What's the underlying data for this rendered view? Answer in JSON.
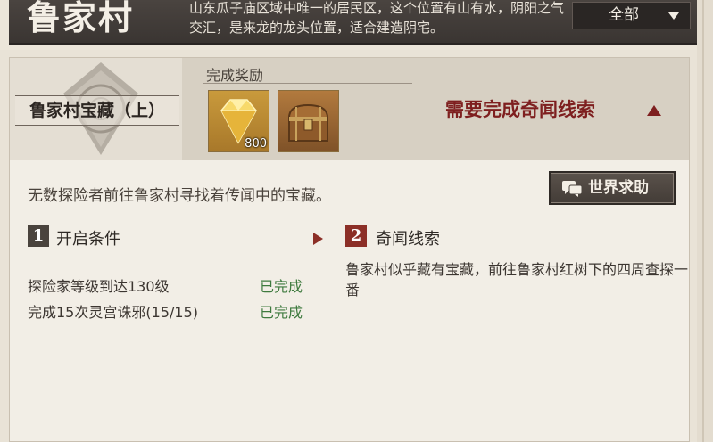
{
  "header": {
    "village_name": "鲁家村",
    "description": "山东瓜子庙区域中唯一的居民区，这个位置有山有水，阴阳之气交汇，是来龙的龙头位置，适合建造阴宅。",
    "filter_value": "全部"
  },
  "quest": {
    "name": "鲁家村宝藏（上）",
    "reward_label": "完成奖励",
    "rewards": [
      {
        "icon": "gold-diamond-icon",
        "count": "800"
      },
      {
        "icon": "treasure-chest-icon",
        "count": ""
      }
    ],
    "requirement": "需要完成奇闻线索",
    "description": "无数探险者前往鲁家村寻找着传闻中的宝藏。",
    "help_label": "世界求助"
  },
  "sections": {
    "conditions": {
      "number": "1",
      "title": "开启条件",
      "items": [
        {
          "label": "探险家等级到达130级",
          "status": "已完成"
        },
        {
          "label": "完成15次灵宫诛邪(15/15)",
          "status": "已完成"
        }
      ]
    },
    "clue": {
      "number": "2",
      "title": "奇闻线索",
      "text": "鲁家村似乎藏有宝藏，前往鲁家村红树下的四周查探一番"
    }
  },
  "colors": {
    "accent_red": "#8c2f27",
    "done_green": "#3e7a3e",
    "header_dark": "#3a3532"
  }
}
